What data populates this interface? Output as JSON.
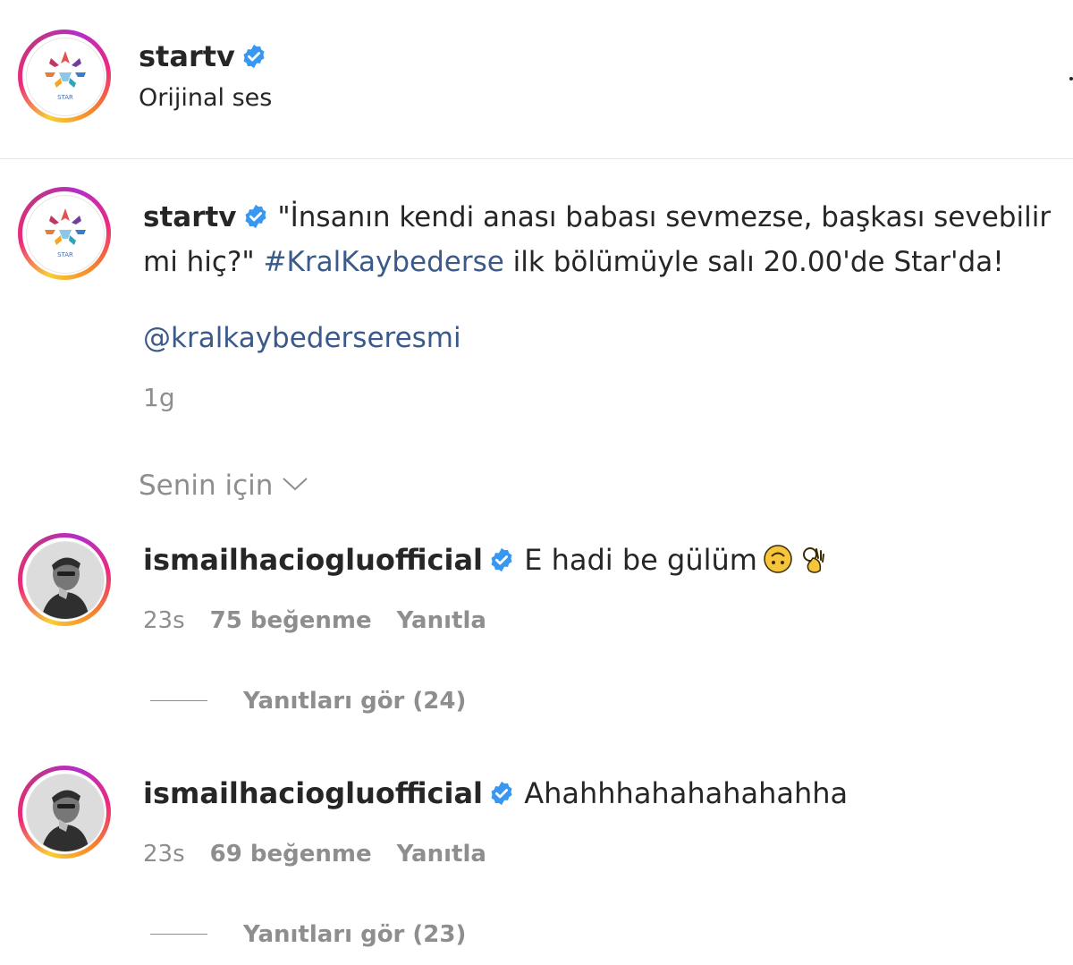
{
  "header": {
    "username": "startv",
    "subtitle": "Orijinal ses",
    "logo_text": "STAR"
  },
  "caption": {
    "username": "startv",
    "text_before_tag": "\"İnsanın kendi anası babası sevmezse, başkası sevebilir mi hiç?\"",
    "hashtag": "#KralKaybederse",
    "text_after_tag": "ilk bölümüyle salı 20.00'de Star'da!",
    "mention": "@kralkaybederseresmi",
    "age": "1g"
  },
  "filter": {
    "label": "Senin için"
  },
  "comments": [
    {
      "username": "ismailhaciogluofficial",
      "text": "E hadi be gülüm",
      "emojis": [
        "upside-down-face-icon",
        "ok-hand-icon"
      ],
      "age": "23s",
      "likes": "75 beğenme",
      "reply_label": "Yanıtla",
      "view_replies": "Yanıtları gör (24)"
    },
    {
      "username": "ismailhaciogluofficial",
      "text": "Ahahhhahahahahahha",
      "age": "23s",
      "likes": "69 beğenme",
      "reply_label": "Yanıtla",
      "view_replies": "Yanıtları gör (23)"
    }
  ],
  "colors": {
    "verified": "#3897f0",
    "hashtag": "#3a5a8a",
    "muted": "#8e8e8e",
    "text": "#262626"
  }
}
